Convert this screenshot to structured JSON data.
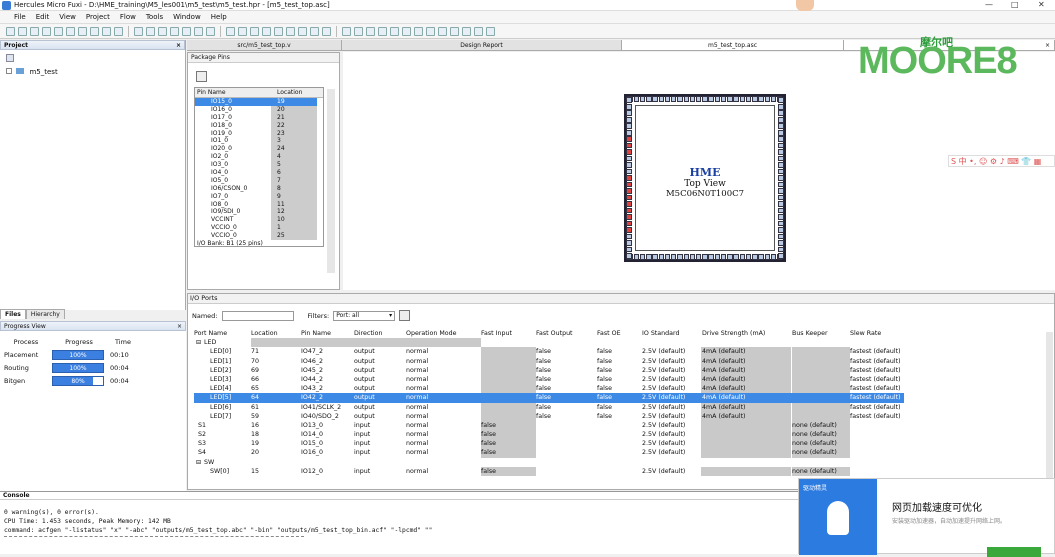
{
  "app": {
    "title": "Hercules Micro Fuxi - D:\\HME_training\\M5_les001\\m5_test\\m5_test.hpr - [m5_test_top.asc]",
    "minimize": "—",
    "maximize": "□",
    "close": "✕"
  },
  "menu": [
    "File",
    "Edit",
    "View",
    "Project",
    "Flow",
    "Tools",
    "Window",
    "Help"
  ],
  "project_panel": {
    "title": "Project",
    "close": "×",
    "tree_root": "m5_test",
    "tabs": [
      "Files",
      "Hierarchy"
    ]
  },
  "progress_panel": {
    "title": "Progress View",
    "close": "×",
    "headers": [
      "Process",
      "Progress",
      "Time"
    ],
    "rows": [
      {
        "process": "Placement",
        "progress_label": "100%",
        "progress": 1.0,
        "time": "00:10"
      },
      {
        "process": "Routing",
        "progress_label": "100%",
        "progress": 1.0,
        "time": "00:04"
      },
      {
        "process": "Bitgen",
        "progress_label": "80%",
        "progress": 0.8,
        "time": "00:04"
      }
    ]
  },
  "editor_tabs": [
    "src/m5_test_top.v",
    "Design Report",
    "m5_test_top.asc"
  ],
  "editor_close": "×",
  "package_pins": {
    "title": "Package Pins",
    "headers": [
      "Pin Name",
      "Location"
    ],
    "rows": [
      [
        "IO15_0",
        "19"
      ],
      [
        "IO16_0",
        "20"
      ],
      [
        "IO17_0",
        "21"
      ],
      [
        "IO18_0",
        "22"
      ],
      [
        "IO19_0",
        "23"
      ],
      [
        "IO1_0",
        "3"
      ],
      [
        "IO20_0",
        "24"
      ],
      [
        "IO2_0",
        "4"
      ],
      [
        "IO3_0",
        "5"
      ],
      [
        "IO4_0",
        "6"
      ],
      [
        "IO5_0",
        "7"
      ],
      [
        "IO6/CSON_0",
        "8"
      ],
      [
        "IO7_0",
        "9"
      ],
      [
        "IO8_0",
        "11"
      ],
      [
        "IO9/SDI_0",
        "12"
      ],
      [
        "VCCINT",
        "10"
      ],
      [
        "VCCIO_0",
        "1"
      ],
      [
        "VCCIO_0",
        "25"
      ]
    ],
    "footer": "I/O Bank: B1 (25 pins)"
  },
  "chip": {
    "brand": "HME",
    "line1": "Top View",
    "line2": "M5C06N0T100C7"
  },
  "logo": {
    "big": "MOORE8",
    "cn": "摩尔吧"
  },
  "io_ports": {
    "title": "I/O Ports",
    "named_label": "Named:",
    "filters_label": "Filters:",
    "filter_value": "Port: all",
    "headers": [
      "Port Name",
      "Location",
      "Pin Name",
      "Direction",
      "Operation Mode",
      "Fast Input",
      "Fast Output",
      "Fast OE",
      "IO Standard",
      "Drive Strength (mA)",
      "Bus Keeper",
      "Slew Rate"
    ],
    "group_led": "LED",
    "group_sw": "SW",
    "led_rows": [
      [
        "LED[0]",
        "71",
        "IO47_2",
        "output",
        "normal",
        "",
        "false",
        "false",
        "2.5V (default)",
        "4mA (default)",
        "",
        "fastest (default)"
      ],
      [
        "LED[1]",
        "70",
        "IO46_2",
        "output",
        "normal",
        "",
        "false",
        "false",
        "2.5V (default)",
        "4mA (default)",
        "",
        "fastest (default)"
      ],
      [
        "LED[2]",
        "69",
        "IO45_2",
        "output",
        "normal",
        "",
        "false",
        "false",
        "2.5V (default)",
        "4mA (default)",
        "",
        "fastest (default)"
      ],
      [
        "LED[3]",
        "66",
        "IO44_2",
        "output",
        "normal",
        "",
        "false",
        "false",
        "2.5V (default)",
        "4mA (default)",
        "",
        "fastest (default)"
      ],
      [
        "LED[4]",
        "65",
        "IO43_2",
        "output",
        "normal",
        "",
        "false",
        "false",
        "2.5V (default)",
        "4mA (default)",
        "",
        "fastest (default)"
      ],
      [
        "LED[5]",
        "64",
        "IO42_2",
        "output",
        "normal",
        "",
        "false",
        "false",
        "2.5V (default)",
        "4mA (default)",
        "",
        "fastest (default)"
      ],
      [
        "LED[6]",
        "61",
        "IO41/SCLK_2",
        "output",
        "normal",
        "",
        "false",
        "false",
        "2.5V (default)",
        "4mA (default)",
        "",
        "fastest (default)"
      ],
      [
        "LED[7]",
        "59",
        "IO40/SDO_2",
        "output",
        "normal",
        "",
        "false",
        "false",
        "2.5V (default)",
        "4mA (default)",
        "",
        "fastest (default)"
      ]
    ],
    "s_rows": [
      [
        "S1",
        "16",
        "IO13_0",
        "input",
        "normal",
        "false",
        "",
        "",
        "2.5V (default)",
        "",
        "none (default)",
        ""
      ],
      [
        "S2",
        "18",
        "IO14_0",
        "input",
        "normal",
        "false",
        "",
        "",
        "2.5V (default)",
        "",
        "none (default)",
        ""
      ],
      [
        "S3",
        "19",
        "IO15_0",
        "input",
        "normal",
        "false",
        "",
        "",
        "2.5V (default)",
        "",
        "none (default)",
        ""
      ],
      [
        "S4",
        "20",
        "IO16_0",
        "input",
        "normal",
        "false",
        "",
        "",
        "2.5V (default)",
        "",
        "none (default)",
        ""
      ]
    ],
    "sw_rows": [
      [
        "SW[0]",
        "15",
        "IO12_0",
        "input",
        "normal",
        "false",
        "",
        "",
        "2.5V (default)",
        "",
        "none (default)",
        ""
      ]
    ]
  },
  "console": {
    "title": "Console",
    "lines": [
      "0 warning(s), 0 error(s).",
      "CPU Time: 1.453 seconds, Peak Memory: 142 MB",
      "command: acfgen \"-listatus\" \"x\" \"-abc\" \"outputs/m5_test_top.abc\" \"-bin\" \"outputs/m5_test_top_bin.acf\" \"-lpcmd\" \"\""
    ]
  },
  "popup": {
    "title": "网页加载速度可优化",
    "body": "安装驱动加速器，自动加速提升网络上网。",
    "brand": "驱动精灵"
  },
  "sogou": "S 中 •, ☺ ⚙ ♪ ⌨ 👕 ▦"
}
